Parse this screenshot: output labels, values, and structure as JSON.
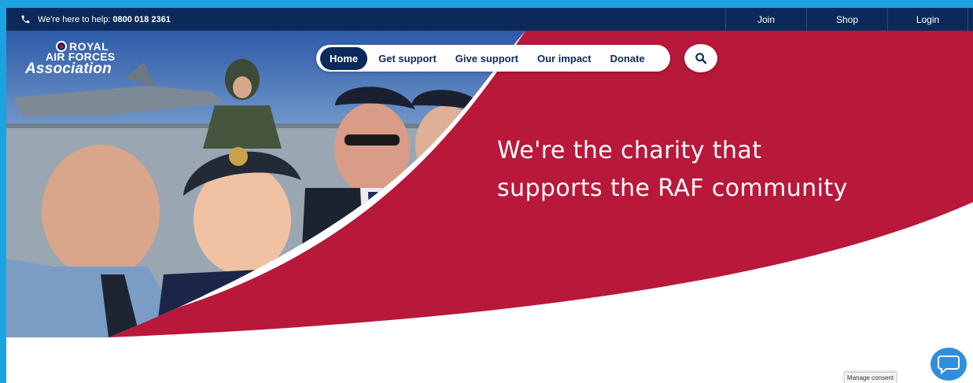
{
  "topbar": {
    "help_text": "We're here to help:",
    "help_number": "0800 018 2361",
    "links": [
      {
        "label": "Join"
      },
      {
        "label": "Shop"
      },
      {
        "label": "Login"
      }
    ]
  },
  "logo": {
    "line1": "ROYAL",
    "line2": "AIR FORCES",
    "line3": "Association"
  },
  "nav": {
    "items": [
      {
        "label": "Home",
        "active": true
      },
      {
        "label": "Get support"
      },
      {
        "label": "Give support"
      },
      {
        "label": "Our impact"
      },
      {
        "label": "Donate"
      }
    ],
    "search_icon": "search-icon"
  },
  "hero": {
    "headline_line1": "We're the charity that",
    "headline_line2": "supports the RAF community"
  },
  "widgets": {
    "consent_label": "Manage consent",
    "chat_icon": "chat-bubble-icon"
  },
  "colors": {
    "navy": "#0b2a5b",
    "crimson": "#b8183a",
    "chat_blue": "#2f8ee0",
    "frame_blue": "#1aa3e0"
  }
}
